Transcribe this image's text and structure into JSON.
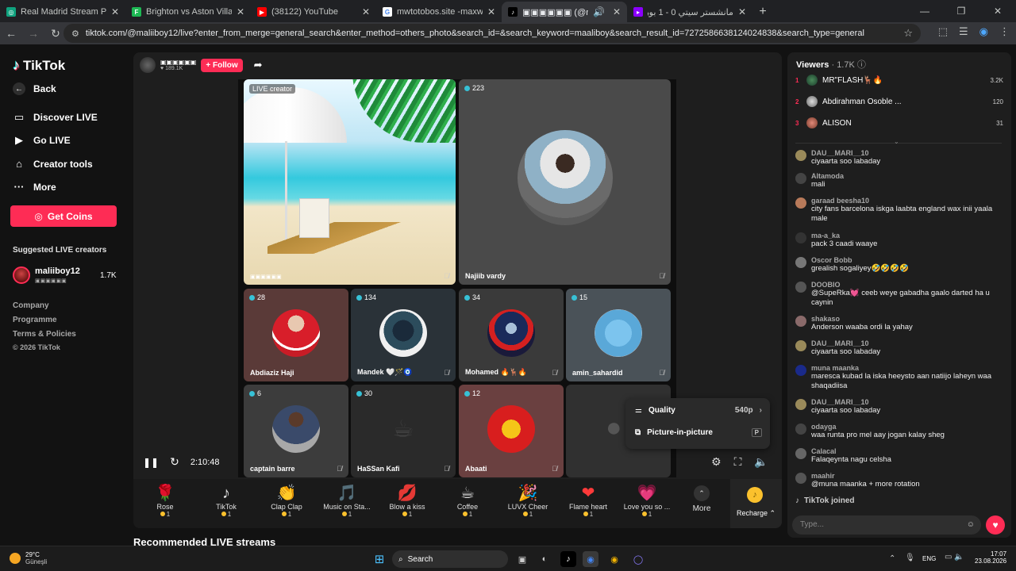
{
  "browser": {
    "tabs": [
      {
        "title": "Real Madrid Stream Plan",
        "fav": "◎",
        "color": "#10a37f"
      },
      {
        "title": "Brighton vs Aston Villa - live sc",
        "fav": "F",
        "color": "#1db954"
      },
      {
        "title": "(38122) YouTube",
        "fav": "▶",
        "color": "#ff0000"
      },
      {
        "title": "mwtotobos.site -maxwin - Pene",
        "fav": "G",
        "color": "#4285f4"
      },
      {
        "title": "▣▣▣▣▣▣ (@maliiboy1",
        "fav": "♪",
        "color": "#111111"
      },
      {
        "title": "مانشستر سيتي 0 - 1 بورنموث | 5",
        "fav": "▸",
        "color": "#8b00ff"
      }
    ],
    "url": "tiktok.com/@maliiboy12/live?enter_from_merge=general_search&enter_method=others_photo&search_id=&search_keyword=maaliboy&search_result_id=7272586638124024838&search_type=general"
  },
  "sidebar": {
    "logo": "TikTok",
    "back": "Back",
    "nav": [
      "Discover LIVE",
      "Go LIVE",
      "Creator tools",
      "More"
    ],
    "get_coins": "Get Coins",
    "suggested_title": "Suggested LIVE creators",
    "suggested": {
      "name": "maliiboy12",
      "sub": "▣▣▣▣▣▣",
      "count": "1.7K"
    },
    "footer": [
      "Company",
      "Programme",
      "Terms & Policies",
      "© 2026 TikTok"
    ]
  },
  "stage": {
    "host_name": "▣▣▣▣▣▣",
    "host_likes": "189.1K",
    "follow": "+ Follow",
    "tiles": [
      {
        "badge": "LIVE creator",
        "name": "▣▣▣▣▣▣"
      },
      {
        "badge": "223",
        "name": "Najiib vardy"
      },
      {
        "badge": "28",
        "name": "Abdiaziz Haji"
      },
      {
        "badge": "134",
        "name": "Mandek 🤍🪄🧿"
      },
      {
        "badge": "34",
        "name": "Mohamed 🔥🦌🔥"
      },
      {
        "badge": "15",
        "name": "amin_sahardid"
      },
      {
        "badge": "6",
        "name": "captain barre"
      },
      {
        "badge": "30",
        "name": "HaSSan Kafi"
      },
      {
        "badge": "12",
        "name": "Abaati"
      }
    ],
    "time": "2:10:48",
    "quality_label": "Quality",
    "quality_value": "540p",
    "pip_label": "Picture-in-picture",
    "pip_key": "P"
  },
  "gifts": [
    {
      "name": "Rose",
      "icon": "🌹",
      "price": "1"
    },
    {
      "name": "TikTok",
      "icon": "♪",
      "price": "1"
    },
    {
      "name": "Clap Clap",
      "icon": "👏",
      "price": "1"
    },
    {
      "name": "Music on Sta...",
      "icon": "🎵",
      "price": "1"
    },
    {
      "name": "Blow a kiss",
      "icon": "💋",
      "price": "1"
    },
    {
      "name": "Coffee",
      "icon": "☕",
      "price": "1"
    },
    {
      "name": "LUVX Cheer",
      "icon": "🎉",
      "price": "1"
    },
    {
      "name": "Flame heart",
      "icon": "❤",
      "price": "1"
    },
    {
      "name": "Love you so ...",
      "icon": "💗",
      "price": "1"
    }
  ],
  "gift_more": "More",
  "recharge": "Recharge",
  "recommended": "Recommended LIVE streams",
  "chat": {
    "viewers_label": "Viewers",
    "viewers_count": "1.7K",
    "top": [
      {
        "rank": "1",
        "name": "MR\"FLASH🦌🔥",
        "count": "3.2K"
      },
      {
        "rank": "2",
        "name": "Abdirahman Osoble ...",
        "count": "120"
      },
      {
        "rank": "3",
        "name": "ALISON",
        "count": "31"
      }
    ],
    "messages": [
      {
        "user": "DAU__MARI__10",
        "text": "ciyaarta soo labaday",
        "color": "#9a8a5a"
      },
      {
        "user": "Altamoda",
        "text": "mali",
        "color": "#444"
      },
      {
        "user": "garaad beesha10",
        "text": "city fans barcelona iskga laabta england wax inii yaala male",
        "color": "#b87a5a"
      },
      {
        "user": "ma-a_ka",
        "text": "pack 3 caadi waaye",
        "color": "#333"
      },
      {
        "user": "Oscor Bobb",
        "text": "grealish sogaliyey🤣🤣🤣🤣",
        "color": "#777"
      },
      {
        "user": "DOOBIO",
        "text": "@SupeRka💓 ceeb weye gabadha gaalo darted ha u caynin",
        "color": "#555"
      },
      {
        "user": "shakaso",
        "text": "Anderson waaba ordi la yahay",
        "color": "#8a6a6a"
      },
      {
        "user": "DAU__MARI__10",
        "text": "ciyaarta soo labaday",
        "color": "#9a8a5a"
      },
      {
        "user": "muna maanka",
        "text": "maresca kubad la iska heeysto aan natiijo laheyn waa shaqadiisa",
        "color": "#1a2a8a"
      },
      {
        "user": "DAU__MARI__10",
        "text": "ciyaarta soo labaday",
        "color": "#9a8a5a"
      },
      {
        "user": "odayga",
        "text": "waa runta pro mel aay jogan kalay sheg",
        "color": "#444"
      },
      {
        "user": "Calacal",
        "text": "Falaqeynta nagu celsha",
        "color": "#666"
      },
      {
        "user": "maahir",
        "text": "@muna maanka + more rotation",
        "color": "#555"
      }
    ],
    "joined": "TikTok  joined",
    "input_placeholder": "Type..."
  },
  "taskbar": {
    "weather_temp": "29°C",
    "weather_desc": "Güneşli",
    "search": "Search",
    "lang": "ENG",
    "time": "17:07",
    "date": "23.08.2026"
  }
}
